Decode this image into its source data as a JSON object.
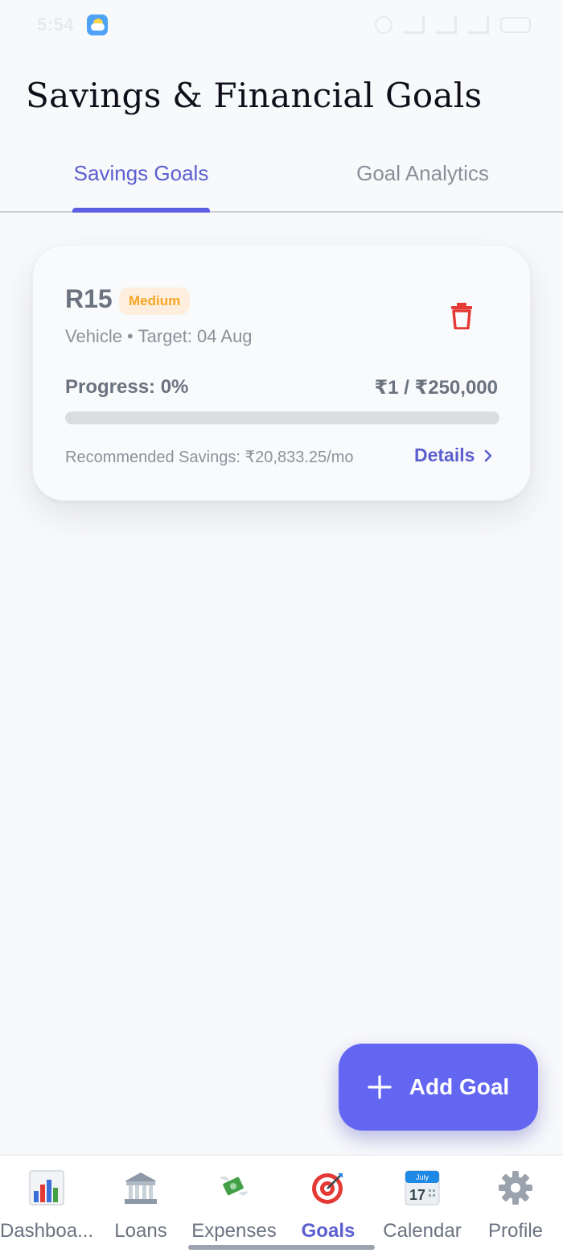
{
  "status_bar": {
    "time": "5:54"
  },
  "header": {
    "title": "Savings & Financial Goals"
  },
  "tabs": [
    {
      "label": "Savings Goals",
      "active": true
    },
    {
      "label": "Goal Analytics",
      "active": false
    }
  ],
  "goals": [
    {
      "name": "R15",
      "priority": "Medium",
      "category": "Vehicle",
      "separator": "•",
      "target_text": "Target: 04 Aug",
      "progress_text": "Progress: 0%",
      "progress_fraction": 0,
      "amount_text": "₹1 / ₹250,000",
      "recommended_text": "Recommended Savings: ₹20,833.25/mo",
      "details_label": "Details"
    }
  ],
  "fab": {
    "label": "Add Goal"
  },
  "bottom_nav": {
    "items": [
      {
        "label": "Dashboa...",
        "icon": "bar-chart-icon"
      },
      {
        "label": "Loans",
        "icon": "bank-icon"
      },
      {
        "label": "Expenses",
        "icon": "money-wings-icon"
      },
      {
        "label": "Goals",
        "icon": "target-icon",
        "active": true
      },
      {
        "label": "Calendar",
        "icon": "calendar-icon",
        "icon_month": "July",
        "icon_day": "17"
      },
      {
        "label": "Profile",
        "icon": "gear-icon"
      }
    ]
  },
  "colors": {
    "accent": "#6366f1",
    "tab_active": "#5b5fcf",
    "priority_medium_bg": "#fdeedd",
    "priority_medium_text": "#f5a623",
    "delete_red": "#e53935"
  }
}
